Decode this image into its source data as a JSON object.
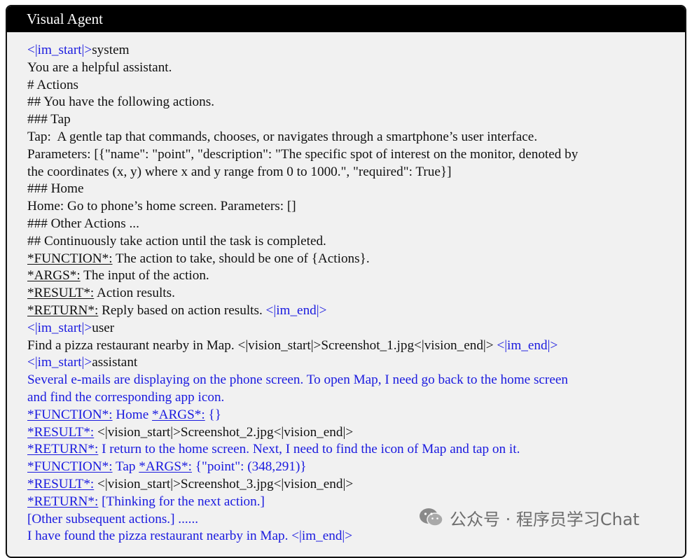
{
  "header": {
    "title": "Visual Agent"
  },
  "lines": [
    [
      {
        "text": "<|im_start|>",
        "cls": "blue"
      },
      {
        "text": "system"
      }
    ],
    [
      {
        "text": "You are a helpful assistant."
      }
    ],
    [
      {
        "text": "# Actions"
      }
    ],
    [
      {
        "text": "## You have the following actions."
      }
    ],
    [
      {
        "text": "### Tap"
      }
    ],
    [
      {
        "text": "Tap:  A gentle tap that commands, chooses, or navigates through a smartphone’s user interface."
      }
    ],
    [
      {
        "text": "Parameters: [{\"name\": \"point\", \"description\": \"The specific spot of interest on the monitor, denoted by"
      }
    ],
    [
      {
        "text": "the coordinates (x, y) where x and y range from 0 to 1000.\", \"required\": True}]"
      }
    ],
    [
      {
        "text": "### Home"
      }
    ],
    [
      {
        "text": "Home: Go to phone’s home screen. Parameters: []"
      }
    ],
    [
      {
        "text": "### Other Actions ..."
      }
    ],
    [
      {
        "text": "## Continuously take action until the task is completed."
      }
    ],
    [
      {
        "text": "*FUNCTION*:",
        "cls": "u"
      },
      {
        "text": " The action to take, should be one of {Actions}."
      }
    ],
    [
      {
        "text": "*ARGS*:",
        "cls": "u"
      },
      {
        "text": " The input of the action."
      }
    ],
    [
      {
        "text": "*RESULT*:",
        "cls": "u"
      },
      {
        "text": " Action results."
      }
    ],
    [
      {
        "text": "*RETURN*:",
        "cls": "u"
      },
      {
        "text": " Reply based on action results. "
      },
      {
        "text": "<|im_end|>",
        "cls": "blue"
      }
    ],
    [
      {
        "text": "<|im_start|>",
        "cls": "blue"
      },
      {
        "text": "user"
      }
    ],
    [
      {
        "text": "Find a pizza restaurant nearby in Map. <|vision_start|>Screenshot_1.jpg<|vision_end|> "
      },
      {
        "text": "<|im_end|>",
        "cls": "blue"
      }
    ],
    [
      {
        "text": "<|im_start|>",
        "cls": "blue"
      },
      {
        "text": "assistant"
      }
    ],
    [
      {
        "text": "Several e-mails are displaying on the phone screen. To open Map, I need go back to the home screen",
        "cls": "blue"
      }
    ],
    [
      {
        "text": "and find the corresponding app icon.",
        "cls": "blue"
      }
    ],
    [
      {
        "text": "*FUNCTION*:",
        "cls": "blue u"
      },
      {
        "text": " Home ",
        "cls": "blue"
      },
      {
        "text": "*ARGS*:",
        "cls": "blue u"
      },
      {
        "text": " {}",
        "cls": "blue"
      }
    ],
    [
      {
        "text": "*RESULT*:",
        "cls": "blue u"
      },
      {
        "text": " <|vision_start|>Screenshot_2.jpg<|vision_end|>"
      }
    ],
    [
      {
        "text": "*RETURN*:",
        "cls": "blue u"
      },
      {
        "text": " I return to the home screen. Next, I need to find the icon of Map and tap on it.",
        "cls": "blue"
      }
    ],
    [
      {
        "text": "*FUNCTION*:",
        "cls": "blue u"
      },
      {
        "text": " Tap ",
        "cls": "blue"
      },
      {
        "text": "*ARGS*:",
        "cls": "blue u"
      },
      {
        "text": " {\"point\": (348,291)}",
        "cls": "blue"
      }
    ],
    [
      {
        "text": "*RESULT*:",
        "cls": "blue u"
      },
      {
        "text": " <|vision_start|>Screenshot_3.jpg<|vision_end|>"
      }
    ],
    [
      {
        "text": "*RETURN*:",
        "cls": "blue u"
      },
      {
        "text": " [Thinking for the next action.]",
        "cls": "blue"
      }
    ],
    [
      {
        "text": "[Other subsequent actions.] ......",
        "cls": "blue"
      }
    ],
    [
      {
        "text": "I have found the pizza restaurant nearby in Map. <|im_end|>",
        "cls": "blue"
      }
    ]
  ],
  "watermark": {
    "text": "公众号 · 程序员学习Chat",
    "icon": "wechat-icon"
  }
}
